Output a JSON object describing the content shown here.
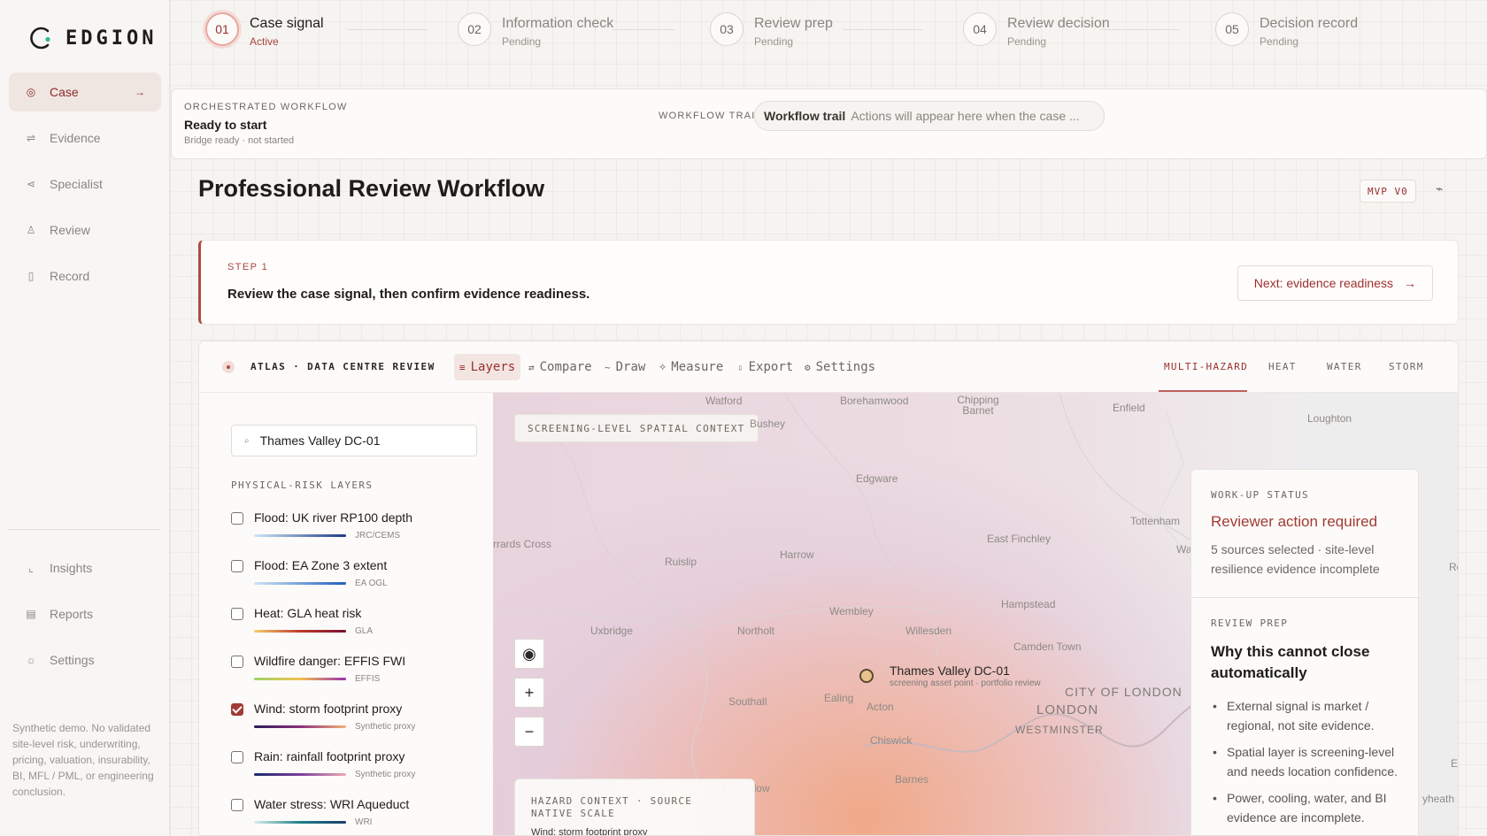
{
  "app": {
    "name": "EDGION"
  },
  "sidebar": {
    "primary": [
      {
        "label": "Case",
        "icon": "target-icon",
        "active": true
      },
      {
        "label": "Evidence",
        "icon": "sliders-icon"
      },
      {
        "label": "Specialist",
        "icon": "share-icon"
      },
      {
        "label": "Review",
        "icon": "user-check-icon"
      },
      {
        "label": "Record",
        "icon": "file-icon"
      }
    ],
    "secondary": [
      {
        "label": "Insights",
        "icon": "chart-icon"
      },
      {
        "label": "Reports",
        "icon": "document-icon"
      },
      {
        "label": "Settings",
        "icon": "gear-icon"
      }
    ],
    "disclaimer": "Synthetic demo. No validated site-level risk, underwriting, pricing, valuation, insurability, BI, MFL / PML, or engineering conclusion."
  },
  "stepper": [
    {
      "num": "01",
      "title": "Case signal",
      "status": "Active"
    },
    {
      "num": "02",
      "title": "Information check",
      "status": "Pending"
    },
    {
      "num": "03",
      "title": "Review prep",
      "status": "Pending"
    },
    {
      "num": "04",
      "title": "Review decision",
      "status": "Pending"
    },
    {
      "num": "05",
      "title": "Decision record",
      "status": "Pending"
    }
  ],
  "orchestration": {
    "eyebrow": "ORCHESTRATED WORKFLOW",
    "title": "Ready to start",
    "subtitle": "Bridge ready · not started",
    "trail_label": "WORKFLOW TRAIL",
    "trail_pill_title": "Workflow trail",
    "trail_pill_text": "Actions will appear here when the case ..."
  },
  "page": {
    "title": "Professional Review Workflow",
    "badge": "MVP V0",
    "icon": "pulse-icon"
  },
  "banner": {
    "eyebrow": "STEP 1",
    "text": "Review the case signal, then confirm evidence readiness.",
    "button": "Next: evidence readiness",
    "button_arrow": "→"
  },
  "atlas": {
    "name": "ATLAS · DATA CENTRE REVIEW",
    "tools": [
      {
        "label": "Layers",
        "icon": "≡",
        "active": true
      },
      {
        "label": "Compare",
        "icon": "⇄"
      },
      {
        "label": "Draw",
        "icon": "~"
      },
      {
        "label": "Measure",
        "icon": "⟡"
      },
      {
        "label": "Export",
        "icon": "⇩"
      },
      {
        "label": "Settings",
        "icon": "⚙"
      }
    ],
    "hazard_tabs": [
      {
        "label": "MULTI-HAZARD",
        "active": true
      },
      {
        "label": "HEAT"
      },
      {
        "label": "WATER"
      },
      {
        "label": "STORM"
      }
    ]
  },
  "layers_panel": {
    "search_value": "Thames Valley DC-01",
    "label": "PHYSICAL-RISK LAYERS",
    "layers": [
      {
        "name": "Flood: UK river RP100 depth",
        "source": "JRC/CEMS",
        "checked": false
      },
      {
        "name": "Flood: EA Zone 3 extent",
        "source": "EA OGL",
        "checked": false
      },
      {
        "name": "Heat: GLA heat risk",
        "source": "GLA",
        "checked": false
      },
      {
        "name": "Wildfire danger: EFFIS FWI",
        "source": "EFFIS",
        "checked": false
      },
      {
        "name": "Wind: storm footprint proxy",
        "source": "Synthetic proxy",
        "checked": true
      },
      {
        "name": "Rain: rainfall footprint proxy",
        "source": "Synthetic proxy",
        "checked": false
      },
      {
        "name": "Water stress: WRI Aqueduct",
        "source": "WRI",
        "checked": false
      }
    ]
  },
  "map": {
    "chip": "SCREENING-LEVEL SPATIAL CONTEXT",
    "places": [
      "Watford",
      "Borehamwood",
      "Chipping Barnet",
      "Enfield",
      "Loughton",
      "Bushey",
      "Edgware",
      "Tottenham",
      "Harrow",
      "East Finchley",
      "Ruislip",
      "Hampstead",
      "Wembley",
      "Uxbridge",
      "Northolt",
      "Willesden",
      "Camden Town",
      "Southall",
      "Ealing",
      "Acton",
      "CITY OF LONDON",
      "LONDON",
      "WESTMINSTER",
      "Chiswick",
      "Barnes",
      "Hounslow",
      "rrards Cross",
      "Wa",
      "Ro",
      "E",
      "yheath"
    ],
    "pin_title": "Thames Valley DC-01",
    "pin_subtitle": "screening asset point · portfolio review",
    "controls": {
      "locate": "◉",
      "zoom_in": "+",
      "zoom_out": "−"
    },
    "hazard_card_eyebrow": "HAZARD CONTEXT · SOURCE NATIVE SCALE",
    "hazard_card_value": "Wind: storm footprint proxy"
  },
  "status_card": {
    "eyebrow": "WORK-UP STATUS",
    "title": "Reviewer action required",
    "text": "5 sources selected · site-level resilience evidence incomplete"
  },
  "prep_card": {
    "eyebrow": "REVIEW PREP",
    "title": "Why this cannot close automatically",
    "items": [
      "External signal is market / regional, not site evidence.",
      "Spatial layer is screening-level and needs location confidence.",
      "Power, cooling, water, and BI evidence are incomplete."
    ]
  },
  "colors": {
    "accent": "#9b2f2f",
    "logo_dot": "#2fb89a",
    "ramps": [
      [
        "#cfe6f5",
        "#1e3a8a"
      ],
      [
        "#cfe6f5",
        "#1f5fbf"
      ],
      [
        "#f6d06b",
        "#c03a2b",
        "#7a1030"
      ],
      [
        "#9ad36a",
        "#f2c14e",
        "#9b2fb0"
      ],
      [
        "#2a1b5a",
        "#8a2f7a",
        "#f3b07a"
      ],
      [
        "#1d2b6b",
        "#7a3f9a",
        "#f0a8b5"
      ],
      [
        "#d8efe9",
        "#1f7f8a",
        "#1b3d6b"
      ]
    ]
  }
}
